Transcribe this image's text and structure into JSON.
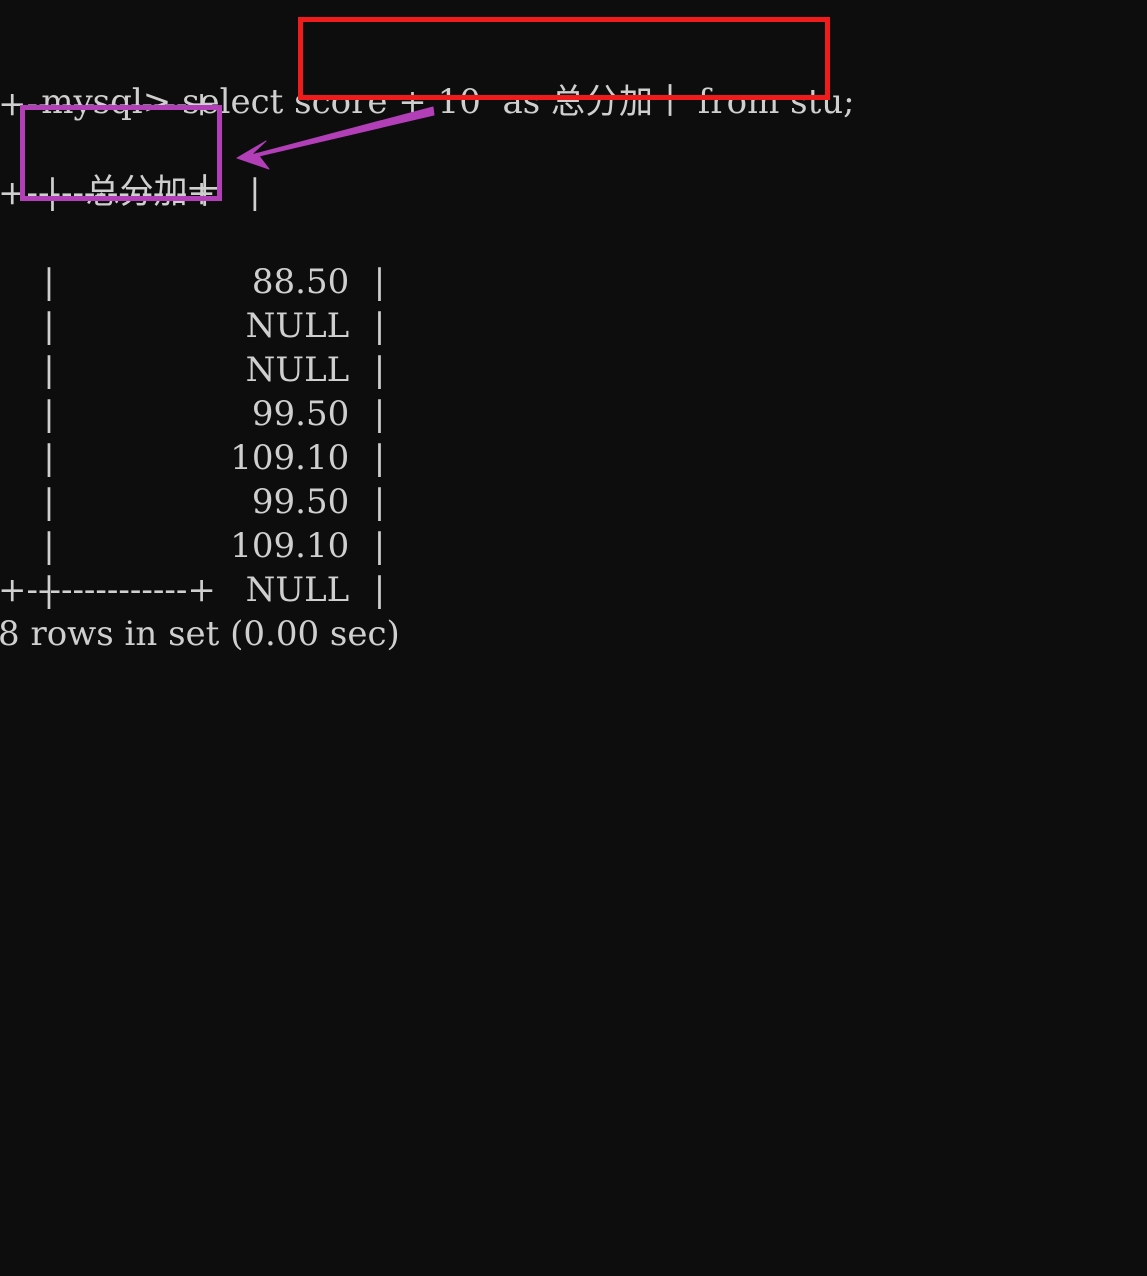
{
  "terminal": {
    "background_color": "#0d0d0d",
    "text_color": "#cfcfcf",
    "prompt_line": {
      "prompt": "mysql> ",
      "keyword_select": "select ",
      "expression": "score + 10",
      "spacing_1": "  ",
      "alias_keyword": "as ",
      "alias_name": "总分加十",
      "keyword_from": " from ",
      "table_name": "stu",
      "terminator": ";",
      "full_text": "mysql> select score + 10  as 总分加十 from stu;"
    },
    "result_table": {
      "separator_top": "+--------------+",
      "separator_header": "+--------------+",
      "separator_bottom": "+--------------+",
      "header_row": {
        "left_border": "|",
        "column_name": "总分加十",
        "right_border": "|"
      },
      "column_name": "总分加十",
      "rows": [
        {
          "value": "88.50"
        },
        {
          "value": "NULL"
        },
        {
          "value": "NULL"
        },
        {
          "value": "99.50"
        },
        {
          "value": "109.10"
        },
        {
          "value": "99.50"
        },
        {
          "value": "109.10"
        },
        {
          "value": "NULL"
        }
      ],
      "row_values": [
        "88.50",
        "NULL",
        "NULL",
        "99.50",
        "109.10",
        "99.50",
        "109.10",
        "NULL"
      ]
    },
    "status_line": {
      "text": "8 rows in set (0.00 sec)",
      "row_count": "8",
      "duration": "0.00 sec"
    }
  },
  "annotations": {
    "red_highlight": {
      "label": "score + 10  as 总分加十",
      "color": "#f01b1b",
      "purpose": "highlights-alias-expression-in-query"
    },
    "purple_highlight": {
      "label": "总分加十",
      "color": "#b23fb8",
      "purpose": "highlights-resulting-column-header"
    },
    "arrow": {
      "color": "#b23fb8",
      "direction": "points-left-to-column-header",
      "from": "alias in query",
      "to": "column header in result"
    }
  }
}
